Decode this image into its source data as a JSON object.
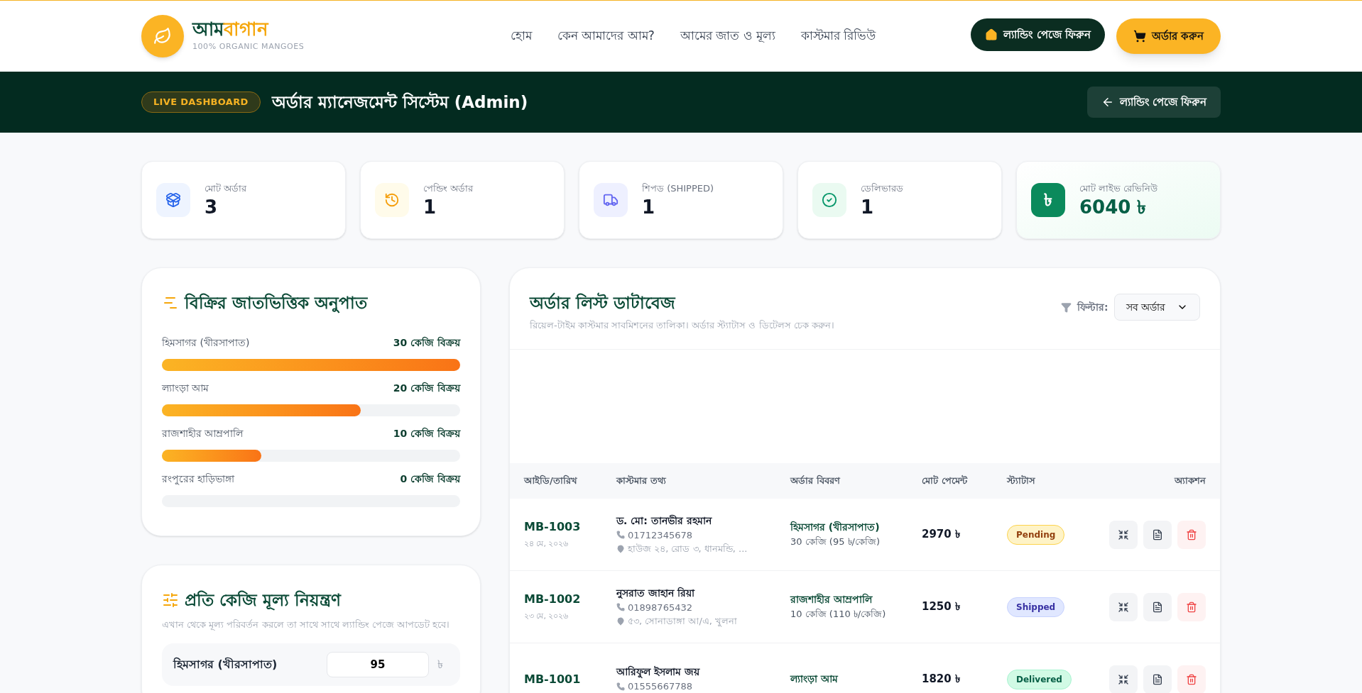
{
  "brand": {
    "name_first": "আম",
    "name_second": "বাগান",
    "tagline": "100% ORGANIC MANGOES"
  },
  "nav": [
    {
      "label": "হোম"
    },
    {
      "label": "কেন আমাদের আম?"
    },
    {
      "label": "আমের জাত ও মূল্য"
    },
    {
      "label": "কাস্টমার রিভিউ"
    }
  ],
  "header_buttons": {
    "back": "ল্যান্ডিং পেজে ফিরুন",
    "order": "অর্ডার করুন"
  },
  "dashboard_bar": {
    "badge": "LIVE DASHBOARD",
    "title": "অর্ডার ম্যানেজমেন্ট সিস্টেম (Admin)",
    "back_button": "ল্যান্ডিং পেজে ফিরুন"
  },
  "stats": [
    {
      "kind": "total",
      "label": "মোট অর্ডার",
      "value": "3"
    },
    {
      "kind": "pending",
      "label": "পেন্ডিং অর্ডার",
      "value": "1"
    },
    {
      "kind": "shipped",
      "label": "শিপড (SHIPPED)",
      "value": "1"
    },
    {
      "kind": "delivered",
      "label": "ডেলিভারড",
      "value": "1"
    },
    {
      "kind": "revenue",
      "label": "মোট লাইভ রেভিনিউ",
      "value": "6040 ৳",
      "icon_text": "৳"
    }
  ],
  "sales_ratio": {
    "title": "বিক্রির জাতভিত্তিক অনুপাত",
    "items": [
      {
        "name": "হিমসাগর (খীরসাপাত)",
        "reading": "30 কেজি বিক্রয়",
        "level": 1
      },
      {
        "name": "ল্যাংড়া আম",
        "reading": "20 কেজি বিক্রয়",
        "level": 0.667
      },
      {
        "name": "রাজশাহীর আম্রপালি",
        "reading": "10 কেজি বিক্রয়",
        "level": 0.333
      },
      {
        "name": "রংপুরের হাড়িভাঙ্গা",
        "reading": "0 কেজি বিক্রয়",
        "level": 0
      }
    ]
  },
  "price_control": {
    "title": "প্রতি কেজি মূল্য নিয়ন্ত্রণ",
    "description": "এখান থেকে মূল্য পরিবর্তন করলে তা সাথে সাথে ল্যান্ডিং পেজে আপডেট হবে।",
    "items": [
      {
        "name": "হিমসাগর (খীরসাপাত)",
        "value": "95",
        "unit": "৳"
      }
    ]
  },
  "orders": {
    "title": "অর্ডার লিস্ট ডাটাবেজ",
    "subtitle": "রিয়েল-টাইম কাস্টমার সাবমিশনের তালিকা। অর্ডার স্ট্যাটাস ও ডিটেলস চেক করুন।",
    "filter_label": "ফিল্টার:",
    "filter_value": "সব অর্ডার",
    "columns": [
      "আইডি/তারিখ",
      "কাস্টমার তথ্য",
      "অর্ডার বিবরণ",
      "মোট পেমেন্ট",
      "স্ট্যাটাস",
      "অ্যাকশন"
    ],
    "rows": [
      {
        "id": "MB-1003",
        "date": "২৪ মে, ২০২৬",
        "customer": "ড. মো: তানভীর রহমান",
        "phone": "01712345678",
        "address": "হাউজ ২৪, রোড ৩, ধানমন্ডি, ...",
        "product": "হিমসাগর (খীরসাপাত)",
        "quantity": "30 কেজি (95 ৳/কেজি)",
        "total": "2970 ৳",
        "status": "Pending",
        "kind": "pending"
      },
      {
        "id": "MB-1002",
        "date": "২৩ মে, ২০২৬",
        "customer": "নুসরাত জাহান রিয়া",
        "phone": "01898765432",
        "address": "৫৩, সোনাডাঙ্গা আ/এ, খুলনা",
        "product": "রাজশাহীর আম্রপালি",
        "quantity": "10 কেজি (110 ৳/কেজি)",
        "total": "1250 ৳",
        "status": "Shipped",
        "kind": "shipped"
      },
      {
        "id": "MB-1001",
        "customer": "আরিফুল ইসলাম জয়",
        "phone": "01555667788",
        "product": "ল্যাংড়া আম",
        "total": "1820 ৳",
        "status": "Delivered",
        "kind": "delivered"
      }
    ]
  }
}
